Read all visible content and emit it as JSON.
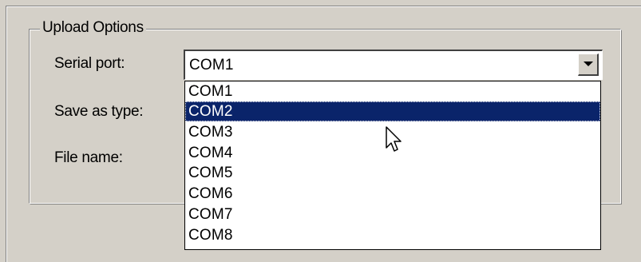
{
  "group": {
    "legend": "Upload Options"
  },
  "labels": {
    "serial_port": "Serial port:",
    "save_as_type": "Save as type:",
    "file_name": "File name:"
  },
  "serial_port_combo": {
    "value": "COM1",
    "button_icon": "chevron-down-icon"
  },
  "dropdown": {
    "selected_index": 1,
    "items": [
      {
        "label": "COM1"
      },
      {
        "label": "COM2"
      },
      {
        "label": "COM3"
      },
      {
        "label": "COM4"
      },
      {
        "label": "COM5"
      },
      {
        "label": "COM6"
      },
      {
        "label": "COM7"
      },
      {
        "label": "COM8"
      }
    ]
  },
  "cursor": {
    "icon": "arrow-cursor-icon"
  },
  "colors": {
    "dialog_bg": "#d4d0c8",
    "selection_bg": "#0a246a",
    "selection_text": "#ffffff"
  }
}
